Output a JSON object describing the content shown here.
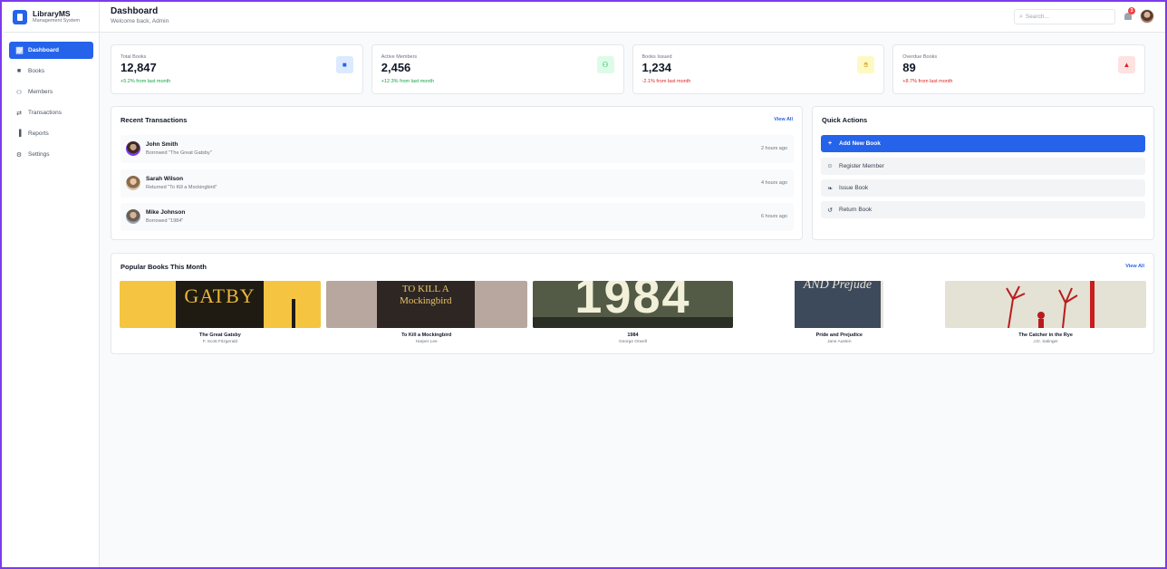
{
  "app": {
    "name": "LibraryMS",
    "subtitle": "Management System"
  },
  "sidebar": {
    "items": [
      {
        "label": "Dashboard",
        "icon": "chart-line-icon",
        "active": true
      },
      {
        "label": "Books",
        "icon": "book-icon"
      },
      {
        "label": "Members",
        "icon": "users-icon"
      },
      {
        "label": "Transactions",
        "icon": "exchange-icon"
      },
      {
        "label": "Reports",
        "icon": "bar-chart-icon"
      },
      {
        "label": "Settings",
        "icon": "gear-icon"
      }
    ]
  },
  "header": {
    "title": "Dashboard",
    "subtitle": "Welcome back, Admin",
    "search_placeholder": "Search...",
    "notification_count": "3"
  },
  "stats": [
    {
      "label": "Total Books",
      "value": "12,847",
      "trend": "+5.2% from last month",
      "direction": "up",
      "icon": "book-icon",
      "color": "#2563eb",
      "bg": "#dbeafe"
    },
    {
      "label": "Active Members",
      "value": "2,456",
      "trend": "+12.3% from last month",
      "direction": "up",
      "icon": "users-icon",
      "color": "#16a34a",
      "bg": "#dcfce7"
    },
    {
      "label": "Books Issued",
      "value": "1,234",
      "trend": "-2.1% from last month",
      "direction": "down",
      "icon": "hand-icon",
      "color": "#ca8a04",
      "bg": "#fef9c3"
    },
    {
      "label": "Overdue Books",
      "value": "89",
      "trend": "+8.7% from last month",
      "direction": "down",
      "icon": "warning-icon",
      "color": "#dc2626",
      "bg": "#fee2e2"
    }
  ],
  "recent_transactions": {
    "title": "Recent Transactions",
    "view_all": "View All",
    "items": [
      {
        "name": "John Smith",
        "description": "Borrowed \"The Great Gatsby\"",
        "time": "2 hours ago"
      },
      {
        "name": "Sarah Wilson",
        "description": "Returned \"To Kill a Mockingbird\"",
        "time": "4 hours ago"
      },
      {
        "name": "Mike Johnson",
        "description": "Borrowed \"1984\"",
        "time": "6 hours ago"
      }
    ]
  },
  "quick_actions": {
    "title": "Quick Actions",
    "items": [
      {
        "label": "Add New Book",
        "icon": "plus-icon",
        "primary": true
      },
      {
        "label": "Register Member",
        "icon": "user-plus-icon"
      },
      {
        "label": "Issue Book",
        "icon": "hand-icon"
      },
      {
        "label": "Return Book",
        "icon": "undo-icon"
      }
    ]
  },
  "popular_books": {
    "title": "Popular Books This Month",
    "view_all": "View All",
    "items": [
      {
        "title": "The Great Gatsby",
        "author": "F. Scott Fitzgerald",
        "cover_text": "GATBY"
      },
      {
        "title": "To Kill a Mockingbird",
        "author": "Harper Lee",
        "cover_text": "TO KILL A Mockingbird"
      },
      {
        "title": "1984",
        "author": "George Orwell",
        "cover_text": "1984"
      },
      {
        "title": "Pride and Prejudice",
        "author": "Jane Austen",
        "cover_text": "AND Prejude"
      },
      {
        "title": "The Catcher in the Rye",
        "author": "J.D. Salinger",
        "cover_text": ""
      }
    ]
  }
}
